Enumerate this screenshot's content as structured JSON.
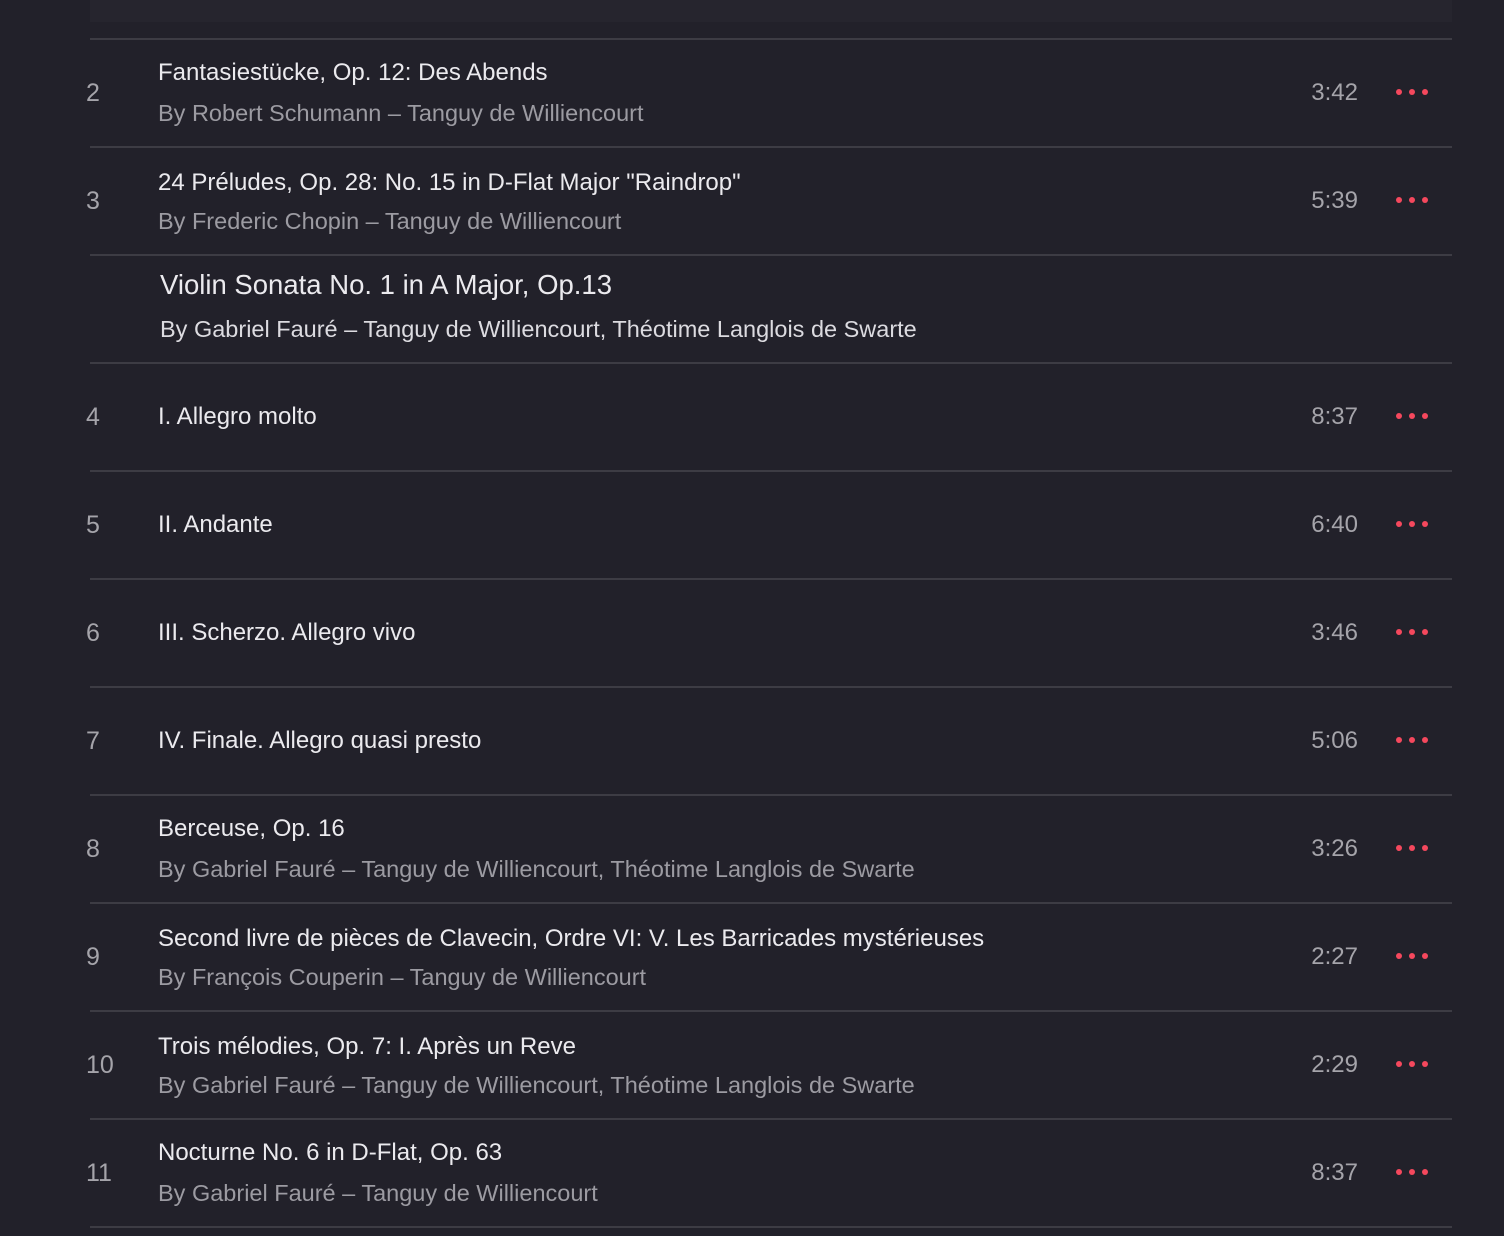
{
  "tracks_before": [
    {
      "number": "2",
      "title": "Fantasiestücke, Op. 12: Des Abends",
      "subtitle": "By Robert Schumann – Tanguy de Williencourt",
      "duration": "3:42"
    },
    {
      "number": "3",
      "title": "24 Préludes, Op. 28: No. 15 in D-Flat Major \"Raindrop\"",
      "subtitle": "By Frederic Chopin – Tanguy de Williencourt",
      "duration": "5:39"
    }
  ],
  "work_header": {
    "title": "Violin Sonata No. 1 in A Major, Op.13",
    "subtitle": "By Gabriel Fauré – Tanguy de Williencourt, Théotime Langlois de Swarte"
  },
  "movements": [
    {
      "number": "4",
      "title": "I. Allegro molto",
      "duration": "8:37"
    },
    {
      "number": "5",
      "title": "II. Andante",
      "duration": "6:40"
    },
    {
      "number": "6",
      "title": "III. Scherzo. Allegro vivo",
      "duration": "3:46"
    },
    {
      "number": "7",
      "title": "IV. Finale. Allegro quasi presto",
      "duration": "5:06"
    }
  ],
  "tracks_after": [
    {
      "number": "8",
      "title": "Berceuse, Op. 16",
      "subtitle": "By Gabriel Fauré – Tanguy de Williencourt, Théotime Langlois de Swarte",
      "duration": "3:26"
    },
    {
      "number": "9",
      "title": "Second livre de pièces de Clavecin, Ordre VI: V. Les Barricades mystérieuses",
      "subtitle": "By François Couperin – Tanguy de Williencourt",
      "duration": "2:27"
    },
    {
      "number": "10",
      "title": "Trois mélodies, Op. 7: I. Après un Reve",
      "subtitle": "By Gabriel Fauré – Tanguy de Williencourt, Théotime Langlois de Swarte",
      "duration": "2:29"
    },
    {
      "number": "11",
      "title": "Nocturne No. 6 in D-Flat, Op. 63",
      "subtitle": "By Gabriel Fauré – Tanguy de Williencourt",
      "duration": "8:37"
    }
  ],
  "icons": {
    "more": "more-ellipsis-icon"
  },
  "colors": {
    "accent": "#f5485d",
    "background": "#22212a",
    "divider": "#3d3c44"
  }
}
